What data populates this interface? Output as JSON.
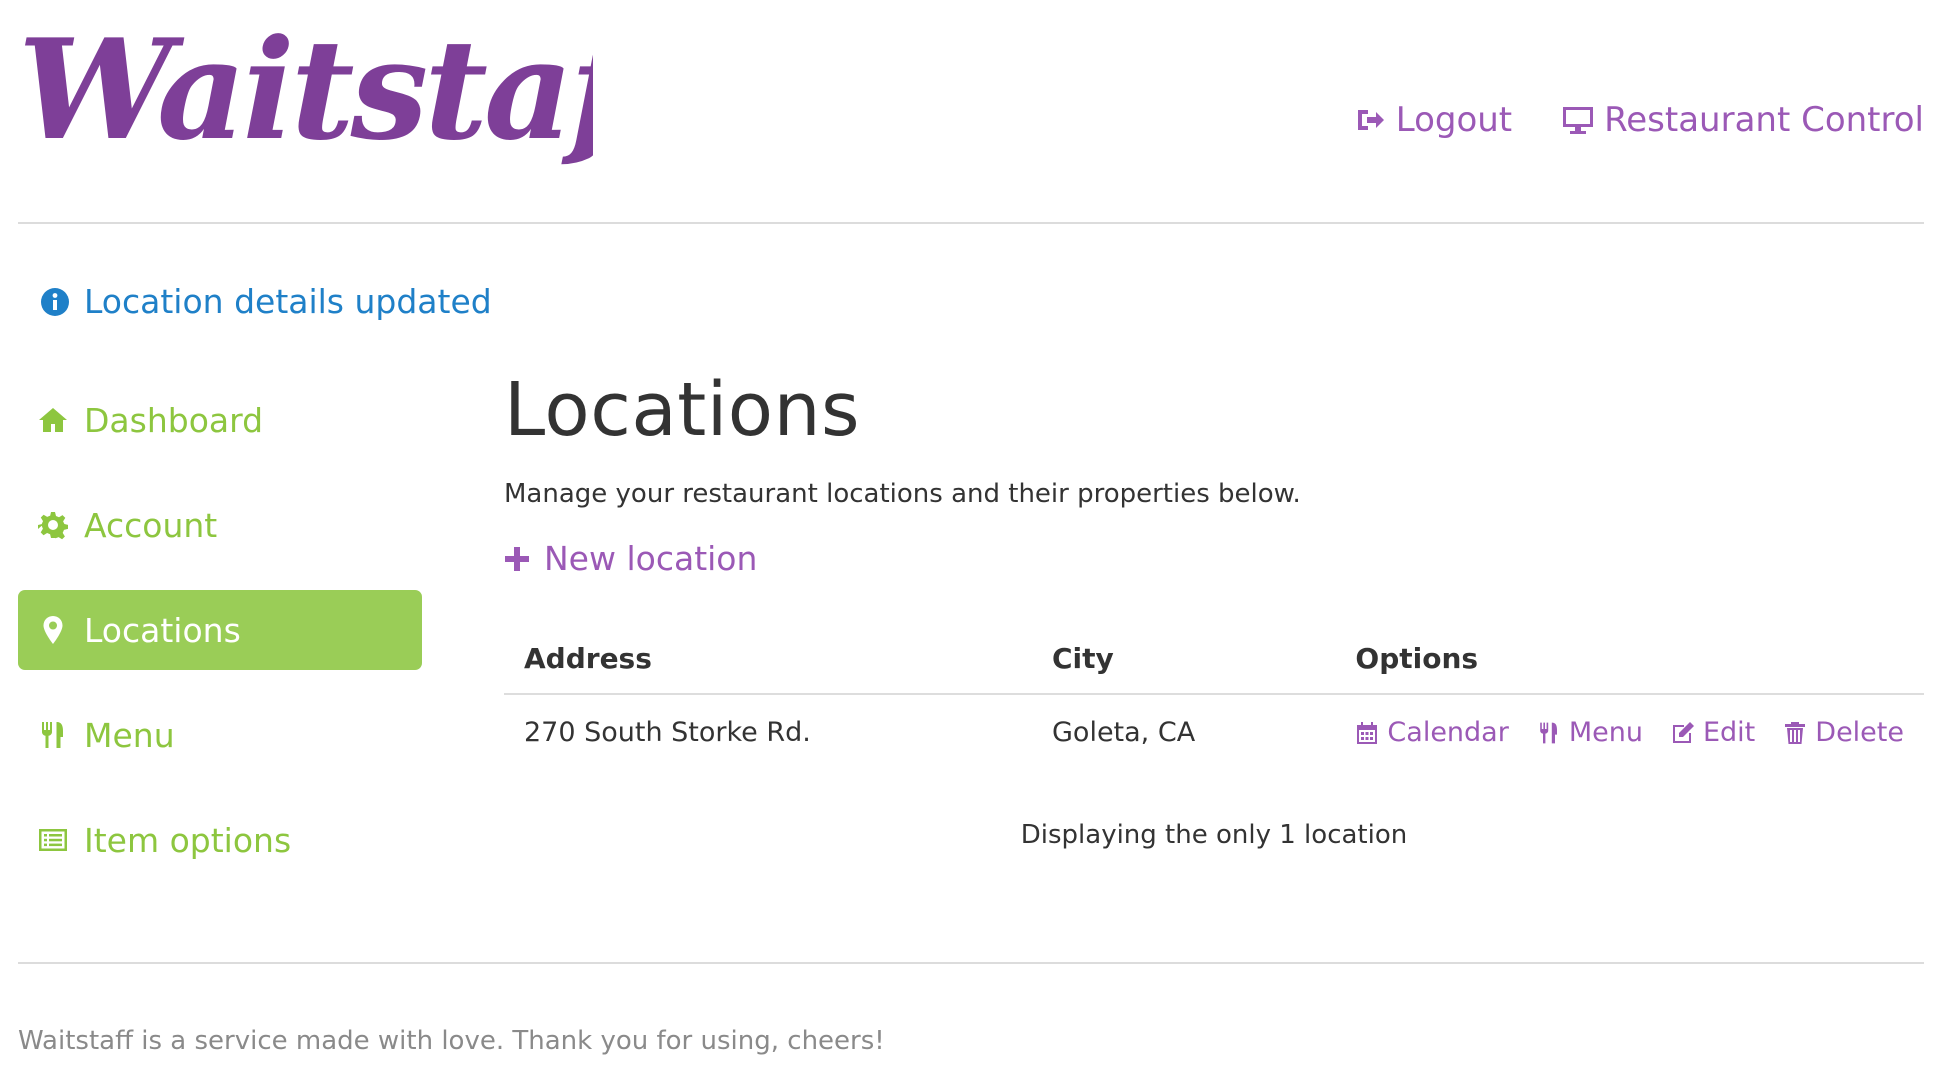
{
  "brand": {
    "name": "Waitstaff",
    "color": "#7e3f98"
  },
  "topnav": {
    "logout": "Logout",
    "restaurant_control": "Restaurant Control"
  },
  "flash": {
    "message": "Location details updated",
    "icon": "info-circle-icon"
  },
  "sidebar": {
    "items": [
      {
        "label": "Dashboard",
        "icon": "home-icon",
        "active": false
      },
      {
        "label": "Account",
        "icon": "gear-icon",
        "active": false
      },
      {
        "label": "Locations",
        "icon": "map-marker-icon",
        "active": true
      },
      {
        "label": "Menu",
        "icon": "cutlery-icon",
        "active": false
      },
      {
        "label": "Item options",
        "icon": "list-alt-icon",
        "active": false
      }
    ]
  },
  "main": {
    "title": "Locations",
    "description": "Manage your restaurant locations and their properties below.",
    "new_location": "New location",
    "table": {
      "headers": [
        "Address",
        "City",
        "Options"
      ],
      "rows": [
        {
          "address": "270 South Storke Rd.",
          "city": "Goleta, CA",
          "options": [
            "Calendar",
            "Menu",
            "Edit",
            "Delete"
          ]
        }
      ]
    },
    "pagination_info": "Displaying the only 1 location"
  },
  "footer": {
    "text": "Waitstaff is a service made with love. Thank you for using, cheers!"
  },
  "colors": {
    "link_purple": "#9b59b6",
    "nav_green": "#8dc63f",
    "active_green": "#9acd57",
    "info_blue": "#1f80c8"
  }
}
